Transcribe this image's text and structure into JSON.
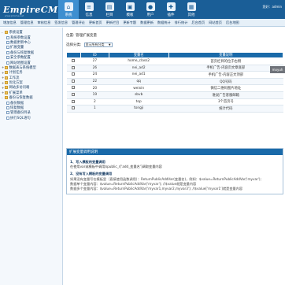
{
  "header": {
    "logo": "EmpireCMS",
    "logo_sub": "www.phome.net",
    "nav": [
      {
        "label": "系统",
        "icon": "home-icon"
      },
      {
        "label": "信息",
        "icon": "document-icon"
      },
      {
        "label": "栏目",
        "icon": "folder-icon"
      },
      {
        "label": "模板",
        "icon": "template-icon"
      },
      {
        "label": "用户",
        "icon": "user-icon"
      },
      {
        "label": "插件",
        "icon": "plugin-icon"
      },
      {
        "label": "其他",
        "icon": "grid-icon"
      }
    ],
    "greeting": "您好：admin"
  },
  "subnav": [
    "增加信息",
    "管理信息",
    "审核信息",
    "签发信息",
    "管理评论",
    "更新首页",
    "更新栏目",
    "更新专题",
    "数据更新",
    "数据统计",
    "排行统计",
    "后台首页",
    "网站首页",
    "后台地图"
  ],
  "sidebar": {
    "items": [
      {
        "label": "系统设置",
        "type": "folder",
        "sign": "-",
        "indent": 0
      },
      {
        "label": "系统参数设置",
        "type": "file",
        "indent": 2
      },
      {
        "label": "数据更新中心",
        "type": "file",
        "indent": 2
      },
      {
        "label": "扩展变量",
        "type": "file",
        "indent": 2
      },
      {
        "label": "备份与恢复数据",
        "type": "file",
        "indent": 2
      },
      {
        "label": "安全参数配置",
        "type": "file",
        "indent": 2
      },
      {
        "label": "网站地图设置",
        "type": "file",
        "indent": 2
      },
      {
        "label": "数据表与系统模型",
        "type": "folder",
        "sign": "+",
        "indent": 0
      },
      {
        "label": "计划任务",
        "type": "folder",
        "sign": "+",
        "indent": 0
      },
      {
        "label": "工作流",
        "type": "folder",
        "sign": "+",
        "indent": 0
      },
      {
        "label": "优化方案",
        "type": "folder",
        "sign": "+",
        "indent": 0
      },
      {
        "label": "网站多访问端",
        "type": "folder",
        "sign": "+",
        "indent": 0
      },
      {
        "label": "扩展菜单",
        "type": "folder",
        "sign": "+",
        "indent": 0
      },
      {
        "label": "备份与恢复数据",
        "type": "folder",
        "sign": "-",
        "indent": 0
      },
      {
        "label": "备份数据",
        "type": "file",
        "indent": 2
      },
      {
        "label": "恢复数据",
        "type": "file",
        "indent": 2
      },
      {
        "label": "管理备份目录",
        "type": "file",
        "indent": 2
      },
      {
        "label": "执行SQL语句",
        "type": "file",
        "indent": 2
      }
    ]
  },
  "main": {
    "breadcrumb": "位置: 管理扩展变量",
    "filter_label": "选择分类:",
    "filter_value": "显示所有分类",
    "table": {
      "headers": [
        "ID",
        "变量名",
        "变量说明"
      ],
      "rows": [
        {
          "id": "27",
          "name": "home_class2",
          "desc": "首页栏目的位于右侧"
        },
        {
          "id": "26",
          "name": "nei_ad2",
          "desc": "手机广告-内容页文章底部"
        },
        {
          "id": "24",
          "name": "nei_ad1",
          "desc": "手机广告-内容正文顶部"
        },
        {
          "id": "22",
          "name": "qq",
          "desc": "QQ号码"
        },
        {
          "id": "20",
          "name": "weixin",
          "desc": "微信二维码图片地址"
        },
        {
          "id": "19",
          "name": "sbvb",
          "desc": "谁说广告客服邮箱"
        },
        {
          "id": "2",
          "name": "top",
          "desc": "3个首页号"
        },
        {
          "id": "1",
          "name": "tongji",
          "desc": "统计代码"
        }
      ]
    },
    "drag_tag": "moyuh"
  },
  "help": {
    "title": "扩展变量调用说明",
    "h1": "1、写入模板的变量调用",
    "l1": "在使用var或模板中调用$public_r['add_变量名']调取变量内容",
    "h2": "2、没有写入模板的变量调用",
    "l2": "如果没有变量写在模板里（直接使用函数调用）：ReturnPublicAddVar(变量名)，例如：$value=ReturnPublicAddVar('myvar');",
    "l3": "数据单个变量内容：$value=ReturnPublicAddVar('myvar'); //$value就是变量内容",
    "l4": "数据多个变量内容：$value=ReturnPublicAddVar('myvar1,myvar2,myvar3'); //$value['myvar1']就是变量内容"
  }
}
